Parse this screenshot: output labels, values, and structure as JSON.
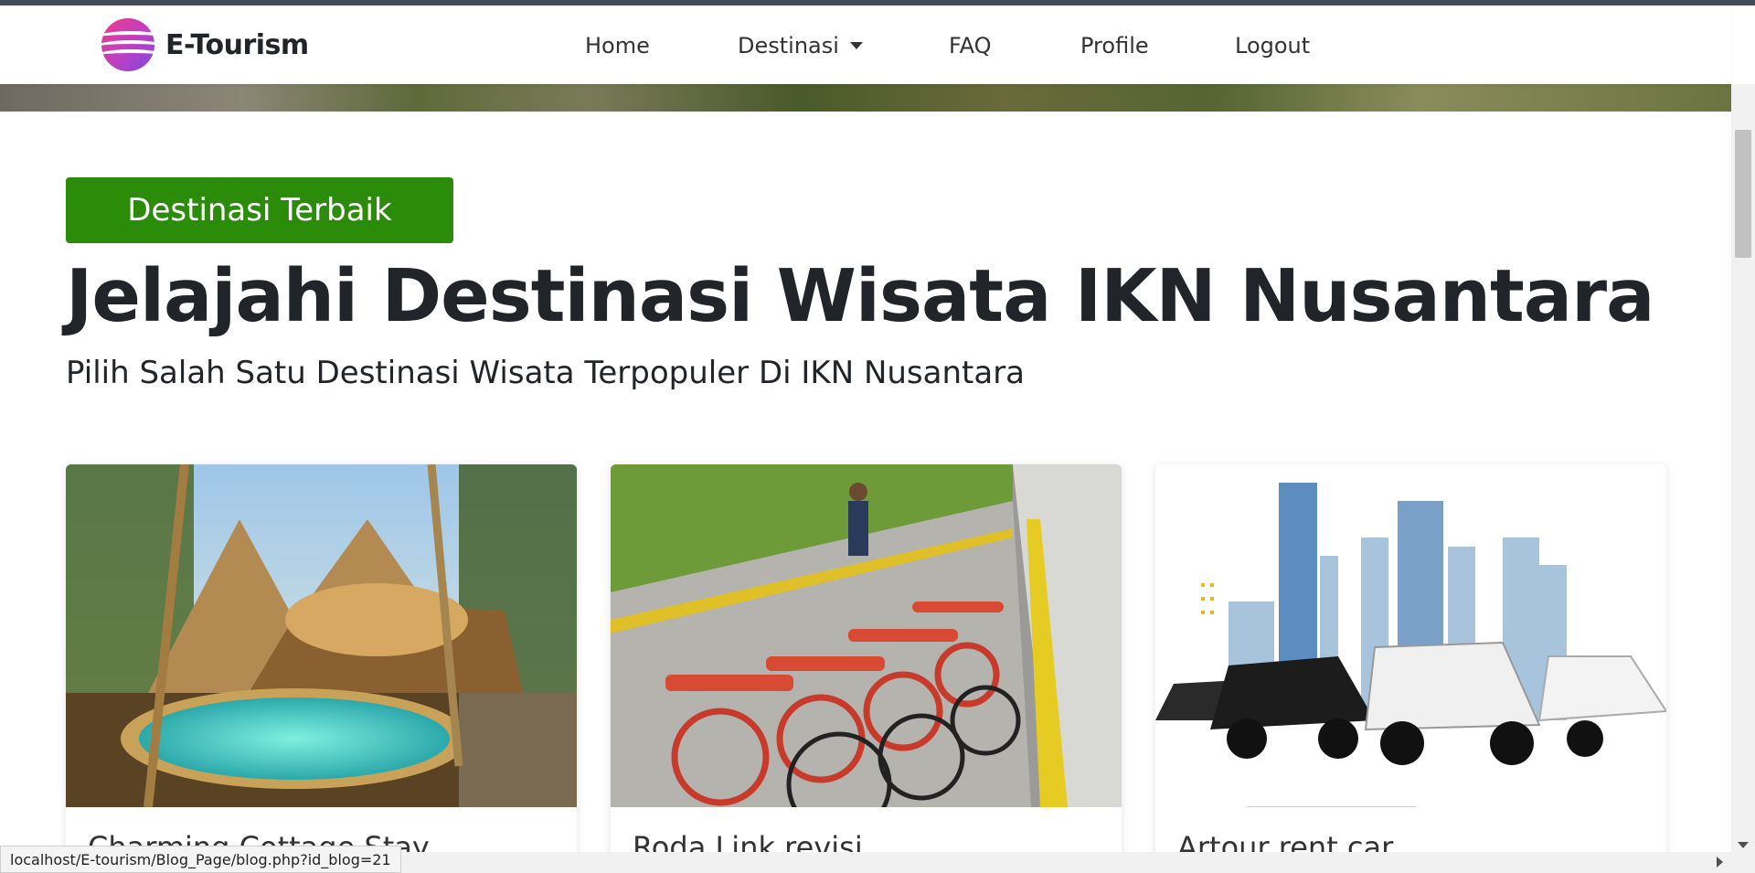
{
  "brand": {
    "name": "E-Tourism",
    "logo_icon": "e-tourism-logo-icon"
  },
  "nav": {
    "home": "Home",
    "destinasi": "Destinasi",
    "faq": "FAQ",
    "profile": "Profile",
    "logout": "Logout"
  },
  "section": {
    "badge": "Destinasi Terbaik",
    "title": "Jelajahi Destinasi Wisata IKN Nusantara",
    "subtitle": "Pilih Salah Satu Destinasi Wisata Terpopuler Di IKN Nusantara"
  },
  "cards": [
    {
      "title": "Charming Cottage Stay"
    },
    {
      "title": "Roda Link revisi"
    },
    {
      "title": "Artour rent car"
    }
  ],
  "status": {
    "url": "localhost/E-tourism/Blog_Page/blog.php?id_blog=21"
  },
  "colors": {
    "accent_green": "#2b8c0a",
    "logo_pink": "#f03a8c",
    "logo_purple": "#7a4ae0"
  }
}
